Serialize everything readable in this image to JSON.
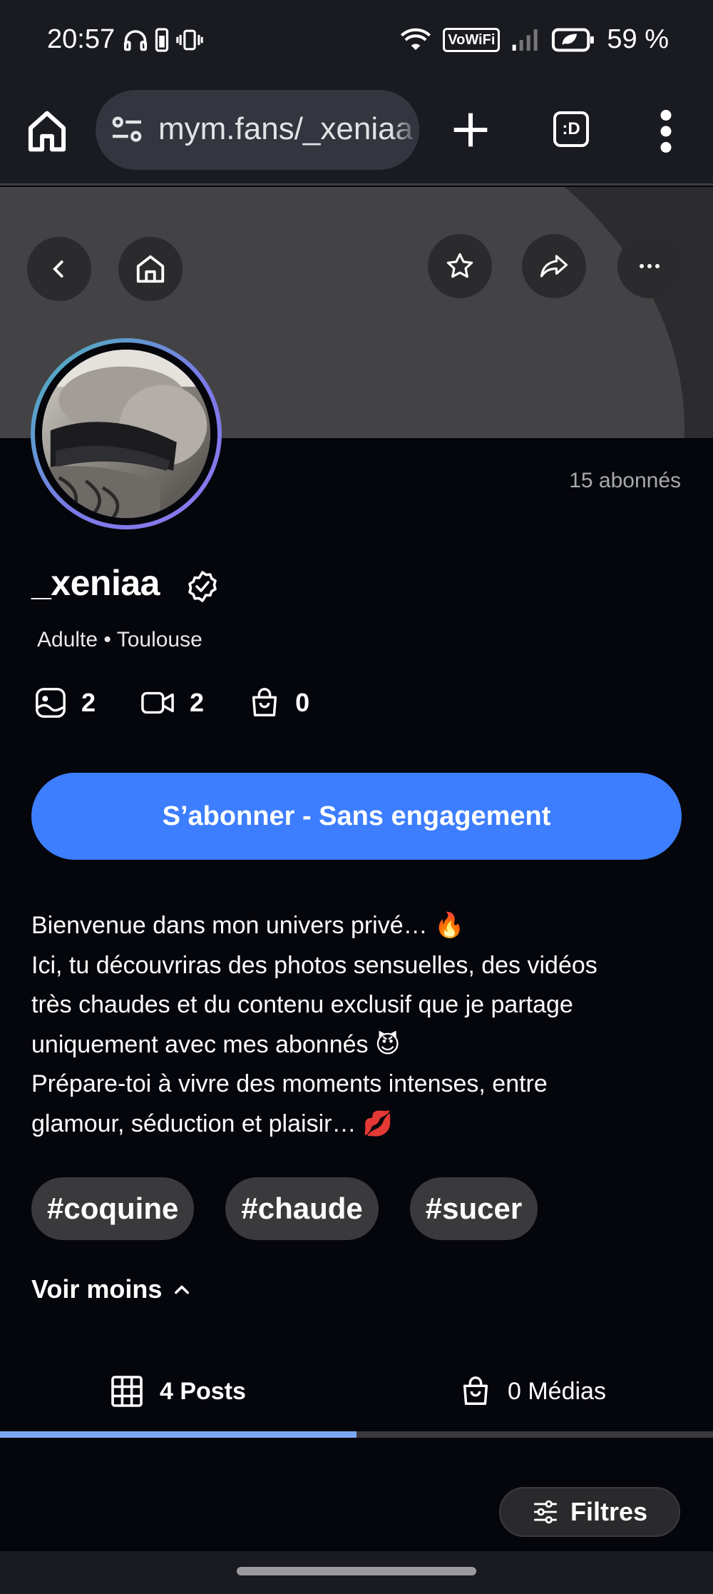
{
  "status_bar": {
    "time": "20:57",
    "vowifi": "VoWiFi",
    "battery": "59 %"
  },
  "browser": {
    "url": "mym.fans/_xeniaa",
    "tabs_count": ":D"
  },
  "profile": {
    "subscribers": "15 abonnés",
    "username": "_xeniaa",
    "meta": "Adulte • Toulouse",
    "stats": {
      "photos": "2",
      "videos": "2",
      "products": "0"
    },
    "subscribe_label": "S’abonner - Sans engagement",
    "bio": [
      "Bienvenue dans mon univers privé… 🔥",
      "Ici, tu découvriras des photos sensuelles, des vidéos",
      "très chaudes et du contenu exclusif que je partage",
      "uniquement avec mes abonnés 😈",
      "Prépare-toi à vivre des moments intenses, entre",
      "glamour, séduction et plaisir… 💋"
    ],
    "tags": [
      "#coquine",
      "#chaude",
      "#sucer"
    ],
    "toggle_label": "Voir moins"
  },
  "tabs": {
    "posts": "4 Posts",
    "media": "0 Médias",
    "active": "posts"
  },
  "filter_label": "Filtres",
  "colors": {
    "accent": "#3d7eff",
    "tab_indicator": "#7aa7f5",
    "background": "#05060b"
  }
}
